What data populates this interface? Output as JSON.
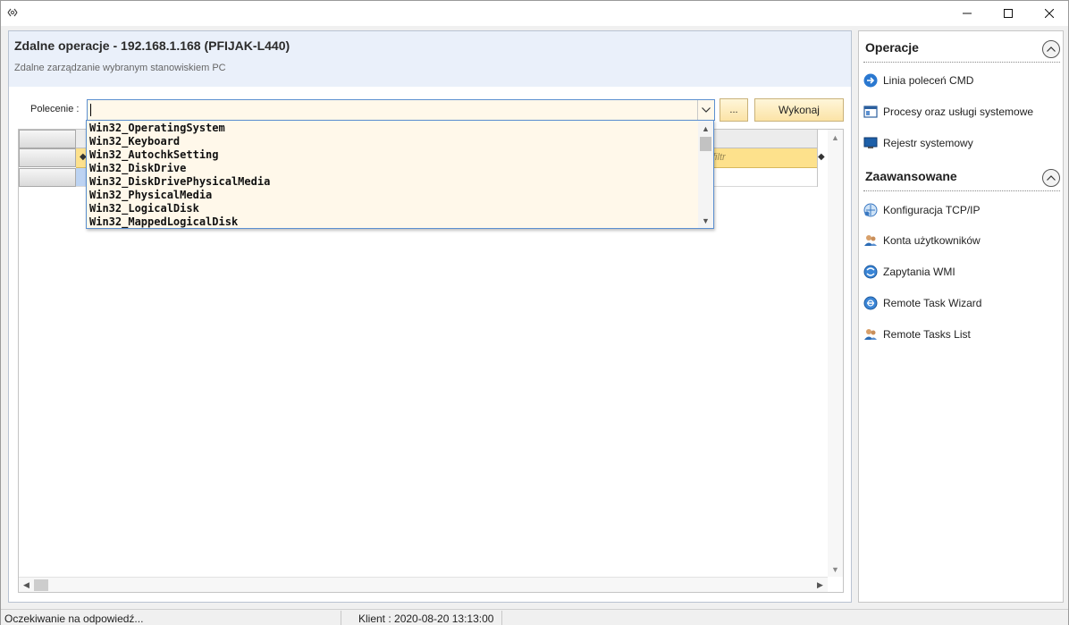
{
  "window": {
    "app_icon": "app-logo-icon"
  },
  "header": {
    "title": "Zdalne operacje - 192.168.1.168 (PFIJAK-L440)",
    "subtitle": "Zdalne zarządzanie wybranym stanowiskiem PC"
  },
  "command": {
    "label": "Polecenie :",
    "value": "",
    "browse_label": "...",
    "execute_label": "Wykonaj"
  },
  "grid": {
    "filter_hint": "filtr"
  },
  "dropdown": {
    "items": [
      "Win32_OperatingSystem",
      "Win32_Keyboard",
      "Win32_AutochkSetting",
      "Win32_DiskDrive",
      "Win32_DiskDrivePhysicalMedia",
      "Win32_PhysicalMedia",
      "Win32_LogicalDisk",
      "Win32_MappedLogicalDisk"
    ]
  },
  "sidebar": {
    "operations_title": "Operacje",
    "operations": [
      {
        "label": "Linia poleceń CMD",
        "icon": "arrow-right-icon"
      },
      {
        "label": "Procesy oraz usługi systemowe",
        "icon": "window-icon"
      },
      {
        "label": "Rejestr systemowy",
        "icon": "monitor-icon"
      }
    ],
    "advanced_title": "Zaawansowane",
    "advanced": [
      {
        "label": "Konfiguracja TCP/IP",
        "icon": "network-icon"
      },
      {
        "label": "Konta użytkowników",
        "icon": "users-icon"
      },
      {
        "label": "Zapytania WMI",
        "icon": "wmi-icon"
      },
      {
        "label": "Remote Task Wizard",
        "icon": "wizard-icon"
      },
      {
        "label": "Remote Tasks List",
        "icon": "tasks-icon"
      }
    ]
  },
  "status": {
    "left": "Oczekiwanie na odpowiedź...",
    "right": "Klient : 2020-08-20 13:13:00"
  },
  "colors": {
    "accent": "#5b8fd0",
    "header_bg": "#eaf0fa",
    "filter_row": "#fde18c",
    "dropdown_bg": "#fff8ea"
  }
}
